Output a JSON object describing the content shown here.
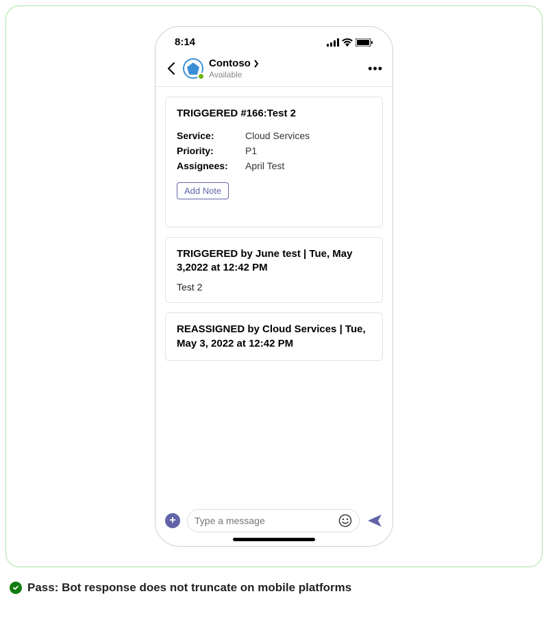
{
  "status_bar": {
    "time": "8:14"
  },
  "header": {
    "title": "Contoso",
    "subtitle": "Available"
  },
  "cards": [
    {
      "title": "TRIGGERED #166:Test 2",
      "rows": [
        {
          "key": "Service:",
          "val": "Cloud Services"
        },
        {
          "key": "Priority:",
          "val": "P1"
        },
        {
          "key": "Assignees:",
          "val": "April Test"
        }
      ],
      "button": "Add Note"
    },
    {
      "title": "TRIGGERED by June test | Tue, May 3,2022 at 12:42 PM",
      "body": "Test 2"
    },
    {
      "title": "REASSIGNED by Cloud Services | Tue, May 3, 2022 at 12:42 PM"
    }
  ],
  "compose": {
    "placeholder": "Type a message"
  },
  "caption": {
    "text": "Pass: Bot response does not truncate on mobile platforms"
  }
}
